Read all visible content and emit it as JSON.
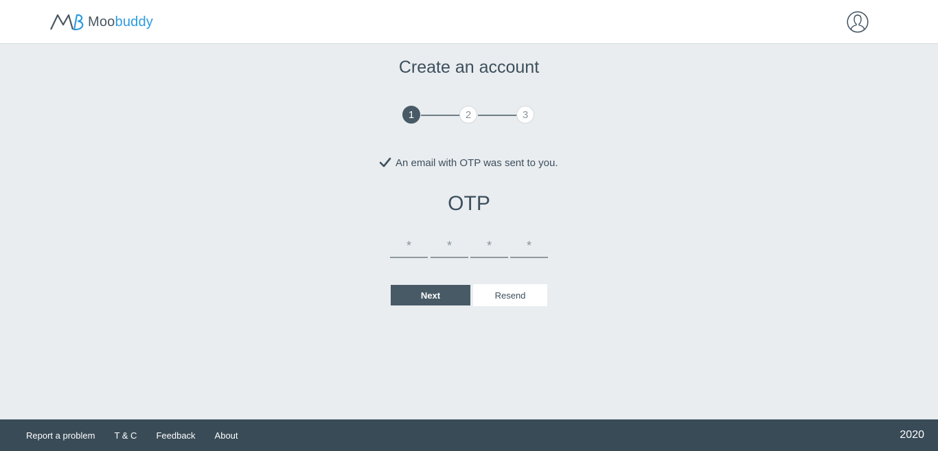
{
  "header": {
    "brand": {
      "part1": "Moo",
      "part2": "buddy"
    },
    "logo_icon": "mb-monogram-icon",
    "account_icon": "user-outline-icon",
    "colors": {
      "brand_blue": "#2c9be0",
      "brand_gray": "#4a5761"
    }
  },
  "main": {
    "title": "Create an account",
    "steps": [
      {
        "label": "1",
        "state": "active"
      },
      {
        "label": "2",
        "state": "pending"
      },
      {
        "label": "3",
        "state": "pending"
      }
    ],
    "notice": {
      "icon": "check-icon",
      "text": "An email with OTP was sent to you."
    },
    "otp_label": "OTP",
    "otp_fields": [
      {
        "placeholder": "*",
        "value": ""
      },
      {
        "placeholder": "*",
        "value": ""
      },
      {
        "placeholder": "*",
        "value": ""
      },
      {
        "placeholder": "*",
        "value": ""
      }
    ],
    "next_label": "Next",
    "resend_label": "Resend"
  },
  "footer": {
    "links": [
      "Report a problem",
      "T & C",
      "Feedback",
      "About"
    ],
    "year": "2020"
  },
  "colors": {
    "page_bg": "#e9edf0",
    "primary": "#475a66",
    "footer_bg": "#394b57"
  }
}
